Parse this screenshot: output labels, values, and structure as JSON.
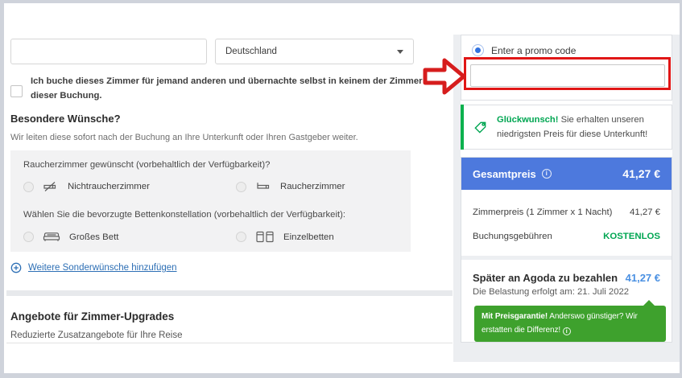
{
  "colors": {
    "header_blue": "#4d79dd",
    "pay_later_blue": "#4a90e2",
    "success_green": "#00a652",
    "guarantee_green": "#3ea12d",
    "annotation_red": "#e01616"
  },
  "form": {
    "name_input": {
      "value": ""
    },
    "country_select": {
      "value": "Deutschland"
    },
    "booking_for_other_label": "Ich buche dieses Zimmer für jemand anderen und übernachte selbst in keinem der Zimmer dieser Buchung.",
    "special_requests": {
      "title": "Besondere Wünsche?",
      "subtitle": "Wir leiten diese sofort nach der Buchung an Ihre Unterkunft oder Ihren Gastgeber weiter.",
      "smoking_question": "Raucherzimmer gewünscht (vorbehaltlich der Verfügbarkeit)?",
      "smoking_options": [
        {
          "label": "Nichtraucherzimmer"
        },
        {
          "label": "Raucherzimmer"
        }
      ],
      "bed_question": "Wählen Sie die bevorzugte Bettenkonstellation (vorbehaltlich der Verfügbarkeit):",
      "bed_options": [
        {
          "label": "Großes Bett"
        },
        {
          "label": "Einzelbetten"
        }
      ],
      "more_requests_link": "Weitere Sonderwünsche hinzufügen"
    },
    "upgrades": {
      "title": "Angebote für Zimmer-Upgrades",
      "subtitle": "Reduzierte Zusatzangebote für Ihre Reise"
    }
  },
  "sidebar": {
    "promo": {
      "radio_label": "Enter a promo code",
      "input_value": ""
    },
    "congrats": {
      "highlight": "Glückwunsch!",
      "message": "Sie erhalten unseren niedrigsten Preis für diese Unterkunft!"
    },
    "price_summary": {
      "total_label": "Gesamtpreis",
      "total_value": "41,27 €",
      "rows": [
        {
          "label": "Zimmerpreis (1 Zimmer x 1 Nacht)",
          "value": "41,27 €"
        },
        {
          "label": "Buchungsgebühren",
          "value": "KOSTENLOS"
        }
      ],
      "pay_later_label": "Später an Agoda zu bezahlen",
      "pay_later_value": "41,27 €",
      "pay_later_note": "Die Belastung erfolgt am: 21. Juli 2022",
      "guarantee_highlight": "Mit Preisgarantie!",
      "guarantee_message": "Anderswo günstiger? Wir erstatten die Differenz!"
    }
  }
}
